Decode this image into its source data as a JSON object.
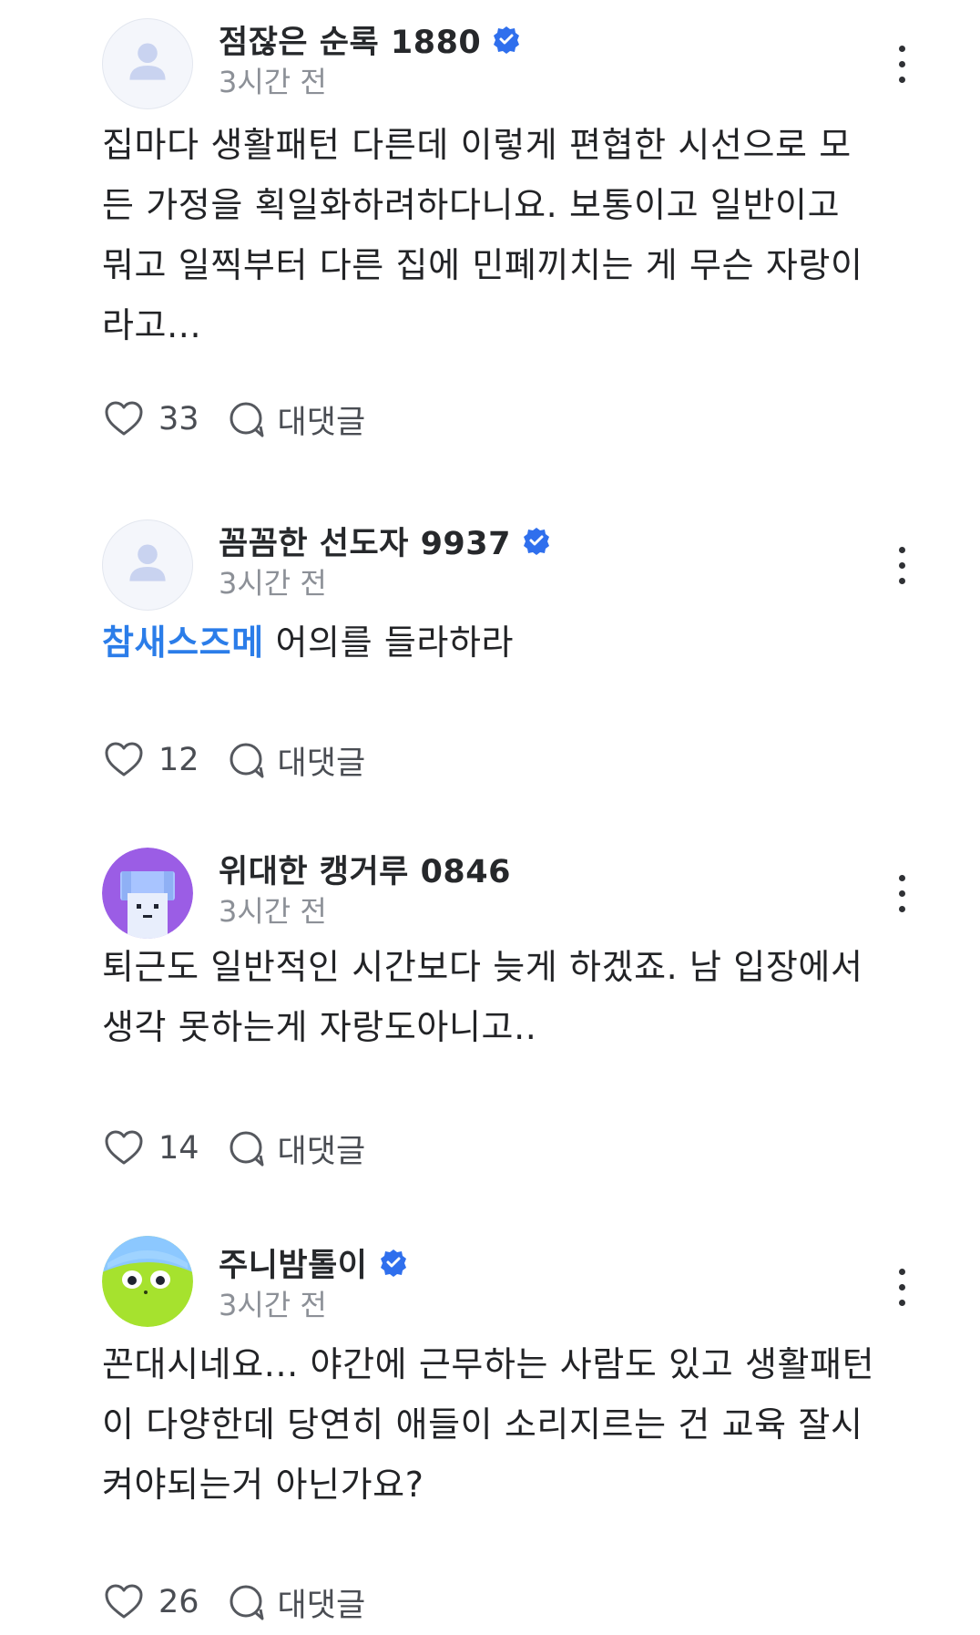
{
  "comments": [
    {
      "author": "점잖은 순록 1880",
      "verified": true,
      "time": "3시간 전",
      "tag": "",
      "lines": [
        "집마다 생활패턴 다른데 이렇게 편협한 시선으로 모",
        "든 가정을 획일화하려하다니요. 보통이고 일반이고",
        "뭐고 일찍부터 다른 집에 민폐끼치는 게 무슨 자랑이",
        "라고..."
      ],
      "likes": "33",
      "reply_label": "대댓글",
      "avatar": "default-user-icon"
    },
    {
      "author": "꼼꼼한 선도자 9937",
      "verified": true,
      "time": "3시간 전",
      "tag": "참새스즈메",
      "lines": [
        " 어의를 들라하라"
      ],
      "likes": "12",
      "reply_label": "대댓글",
      "avatar": "default-user-icon"
    },
    {
      "author": "위대한 캥거루 0846",
      "verified": false,
      "time": "3시간 전",
      "tag": "",
      "lines": [
        "퇴근도 일반적인 시간보다 늦게 하겠죠. 남 입장에서",
        "생각 못하는게 자랑도아니고.."
      ],
      "likes": "14",
      "reply_label": "대댓글",
      "avatar": "purple-character-icon"
    },
    {
      "author": "주니밤톨이",
      "verified": true,
      "time": "3시간 전",
      "tag": "",
      "lines": [
        "꼰대시네요... 야간에 근무하는 사람도 있고 생활패턴",
        "이 다양한데 당연히 애들이 소리지르는 건 교육 잘시",
        "켜야되는거 아닌가요?"
      ],
      "likes": "26",
      "reply_label": "대댓글",
      "avatar": "green-character-icon"
    }
  ],
  "colors": {
    "verified": "#2f6fed",
    "tag": "#2b7de9",
    "purple_avatar": "#9b5de5",
    "green_avatar": "#a6e22e"
  }
}
